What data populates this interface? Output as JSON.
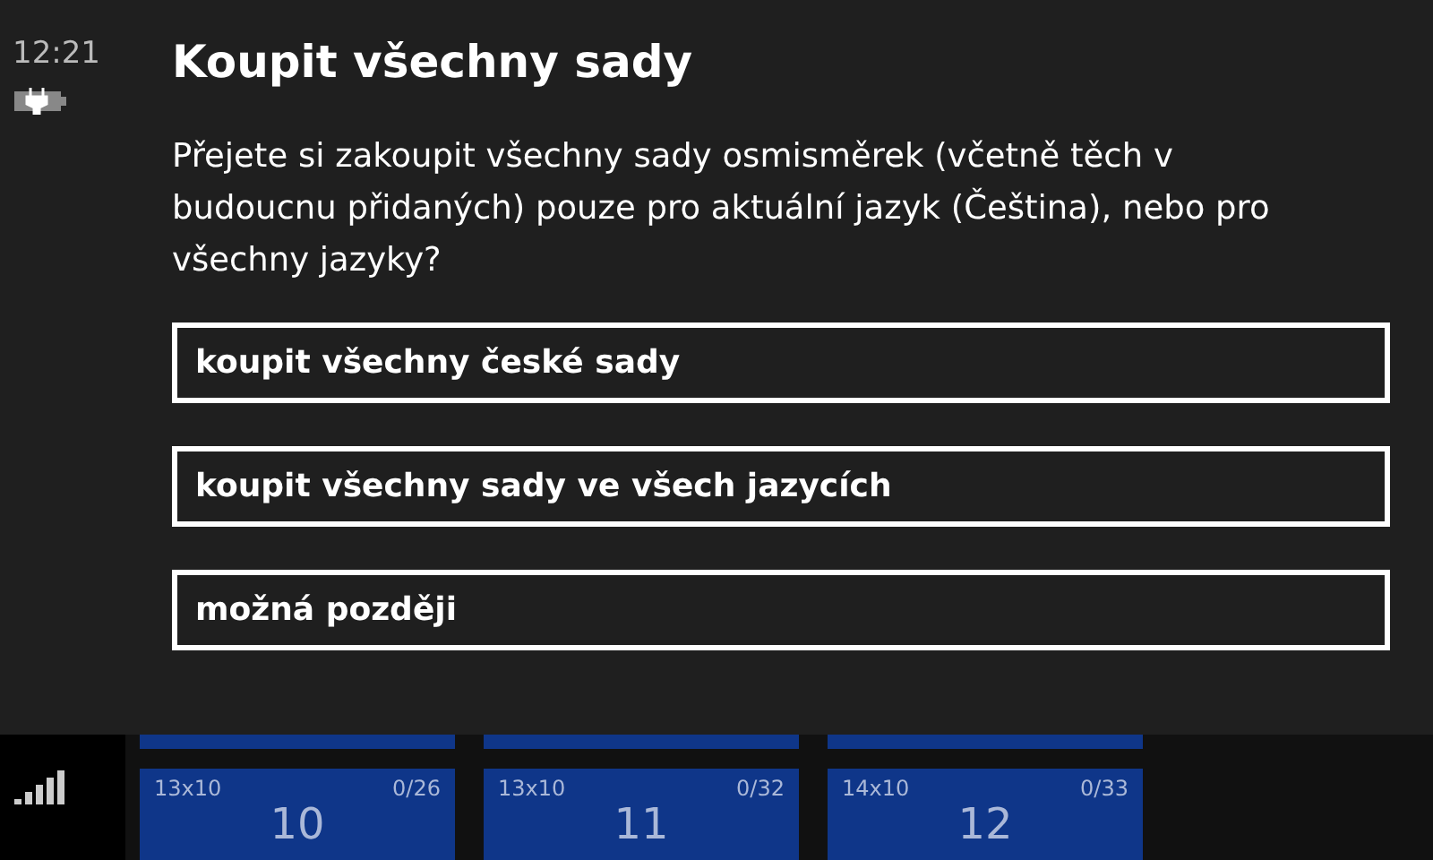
{
  "status_bar": {
    "time": "12:21"
  },
  "dialog": {
    "title": "Koupit všechny sady",
    "message": "Přejete si zakoupit všechny sady osmisměrek (včetně těch v budoucnu přidaných) pouze pro aktuální jazyk (Čeština), nebo pro všechny jazyky?",
    "buttons": [
      "koupit všechny české sady",
      "koupit všechny sady ve všech jazycích",
      "možná později"
    ]
  },
  "tiles": [
    {
      "size": "13x10",
      "progress": "0/26",
      "number": "10"
    },
    {
      "size": "13x10",
      "progress": "0/32",
      "number": "11"
    },
    {
      "size": "14x10",
      "progress": "0/33",
      "number": "12"
    }
  ]
}
